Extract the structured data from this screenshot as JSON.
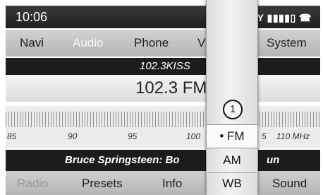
{
  "status_bar": {
    "time": "10:06",
    "right_text": "OY ▮▮▮▮▯ ☎"
  },
  "main_menu": {
    "items": [
      "Navi",
      "Audio",
      "Phone",
      "V",
      "System"
    ],
    "selected": "Audio"
  },
  "station": {
    "name": "102.3KISS",
    "frequency": "102.3 FM"
  },
  "scale": {
    "labels": [
      "85",
      "90",
      "95",
      "100",
      "5",
      "110 MHz"
    ]
  },
  "now_playing": {
    "track": "Bruce Springsteen: Bo",
    "track_tail": "un"
  },
  "bottom_menu": {
    "items": [
      "Radio",
      "Presets",
      "Info",
      "Sound"
    ]
  },
  "band_popup": {
    "callout": "1",
    "options": [
      {
        "label": "• FM",
        "selected": true
      },
      {
        "label": "AM",
        "selected": false
      },
      {
        "label": "WB",
        "selected": false
      }
    ]
  }
}
